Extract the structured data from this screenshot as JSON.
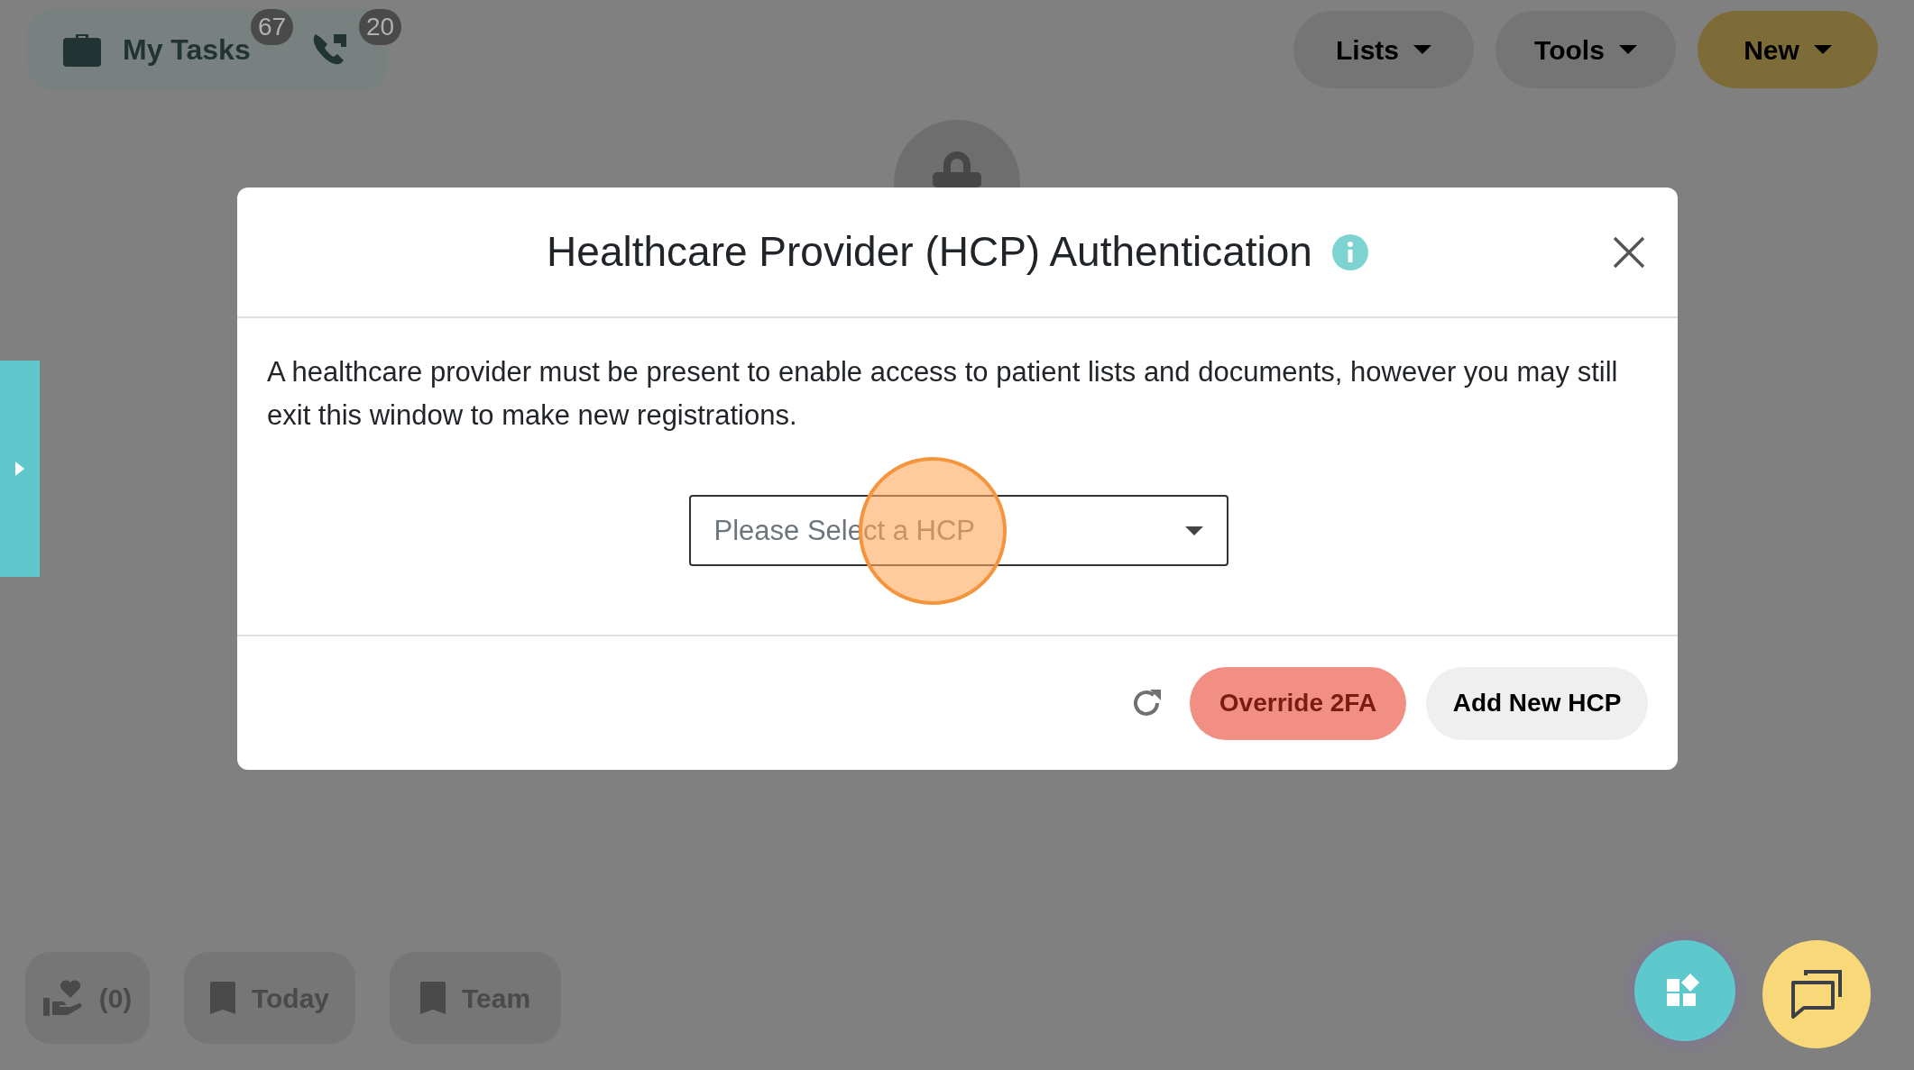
{
  "top_bar": {
    "my_tasks": {
      "label": "My Tasks",
      "badge": "67"
    },
    "calls": {
      "badge": "20"
    },
    "menus": [
      {
        "label": "Lists",
        "kind": "plain"
      },
      {
        "label": "Tools",
        "kind": "plain"
      },
      {
        "label": "New",
        "kind": "primary"
      }
    ]
  },
  "dialog": {
    "title": "Healthcare Provider (HCP) Authentication",
    "description": "A healthcare provider must be present to enable access to patient lists and documents, however you may still exit this window to make new registrations.",
    "select": {
      "placeholder": "Please Select a HCP"
    },
    "buttons": [
      {
        "label": "Override 2FA",
        "kind": "danger"
      },
      {
        "label": "Add New HCP",
        "kind": "secondary"
      }
    ]
  },
  "bottom_bar": {
    "items": [
      {
        "label": "(0)",
        "kind": "heart"
      },
      {
        "label": "Today",
        "kind": "bookmark"
      },
      {
        "label": "Team",
        "kind": "bookmark"
      }
    ]
  }
}
